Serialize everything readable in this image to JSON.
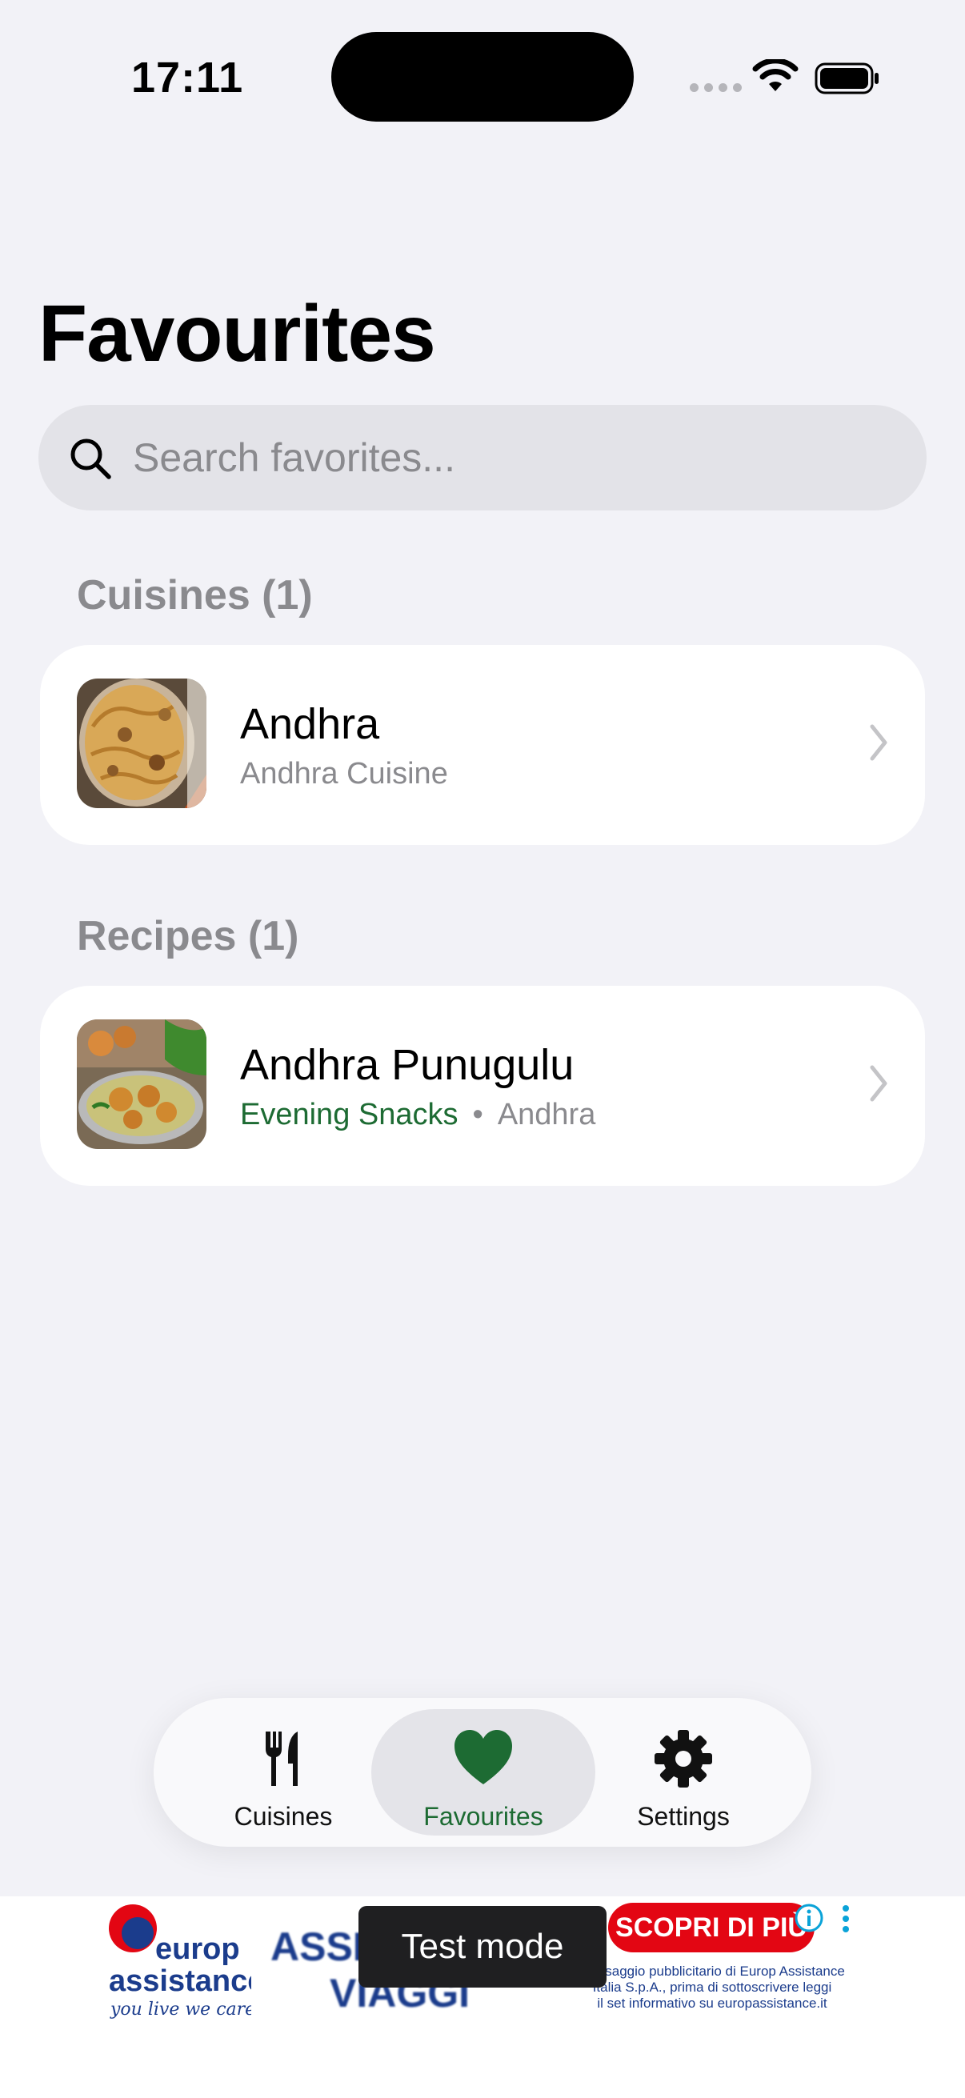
{
  "status_bar": {
    "time": "17:11"
  },
  "page": {
    "title": "Favourites"
  },
  "search": {
    "placeholder": "Search favorites...",
    "value": ""
  },
  "sections": [
    {
      "header": "Cuisines (1)",
      "items": [
        {
          "title": "Andhra",
          "subtitle": "Andhra Cuisine",
          "image": "biryani-photo"
        }
      ]
    },
    {
      "header": "Recipes (1)",
      "items": [
        {
          "title": "Andhra Punugulu",
          "category": "Evening Snacks",
          "separator": "•",
          "cuisine": "Andhra",
          "image": "punugulu-photo"
        }
      ]
    }
  ],
  "tabbar": {
    "tabs": [
      {
        "label": "Cuisines",
        "icon": "fork-knife-icon",
        "active": false
      },
      {
        "label": "Favourites",
        "icon": "heart-icon",
        "active": true
      },
      {
        "label": "Settings",
        "icon": "gear-icon",
        "active": false
      }
    ]
  },
  "ad": {
    "brand_line1": "europ",
    "brand_line2": "assistance",
    "tagline": "you live we care",
    "mid_text_1": "ASSIC",
    "mid_text_2": "VIAGGI",
    "cta": "SCOPRI DI PIÙ",
    "disclaimer_1": "Messaggio pubblicitario di Europ Assistance",
    "disclaimer_2": "Italia S.p.A., prima di sottoscrivere leggi",
    "disclaimer_3": "il set informativo su europassistance.it",
    "test_label": "Test mode"
  },
  "colors": {
    "accent": "#1D6B33",
    "background": "#F2F2F7",
    "ad_red": "#E30613",
    "ad_blue": "#1B3C8C"
  }
}
